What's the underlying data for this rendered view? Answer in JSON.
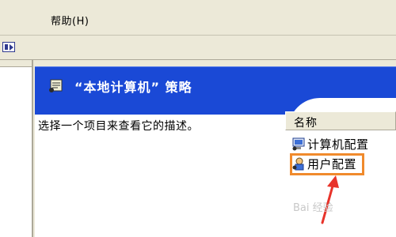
{
  "menubar": {
    "help_label": "帮助(H)"
  },
  "policy": {
    "banner_title": "“本地计算机” 策略",
    "description": "选择一个项目来查看它的描述。",
    "column_header": "名称",
    "items": [
      {
        "label": "计算机配置",
        "icon": "computer-config-icon"
      },
      {
        "label": "用户配置",
        "icon": "user-config-icon"
      }
    ]
  },
  "colors": {
    "banner": "#1a49d6",
    "highlight": "#f08a2c",
    "arrow": "#e8332a"
  },
  "watermark": "Bai 经验"
}
